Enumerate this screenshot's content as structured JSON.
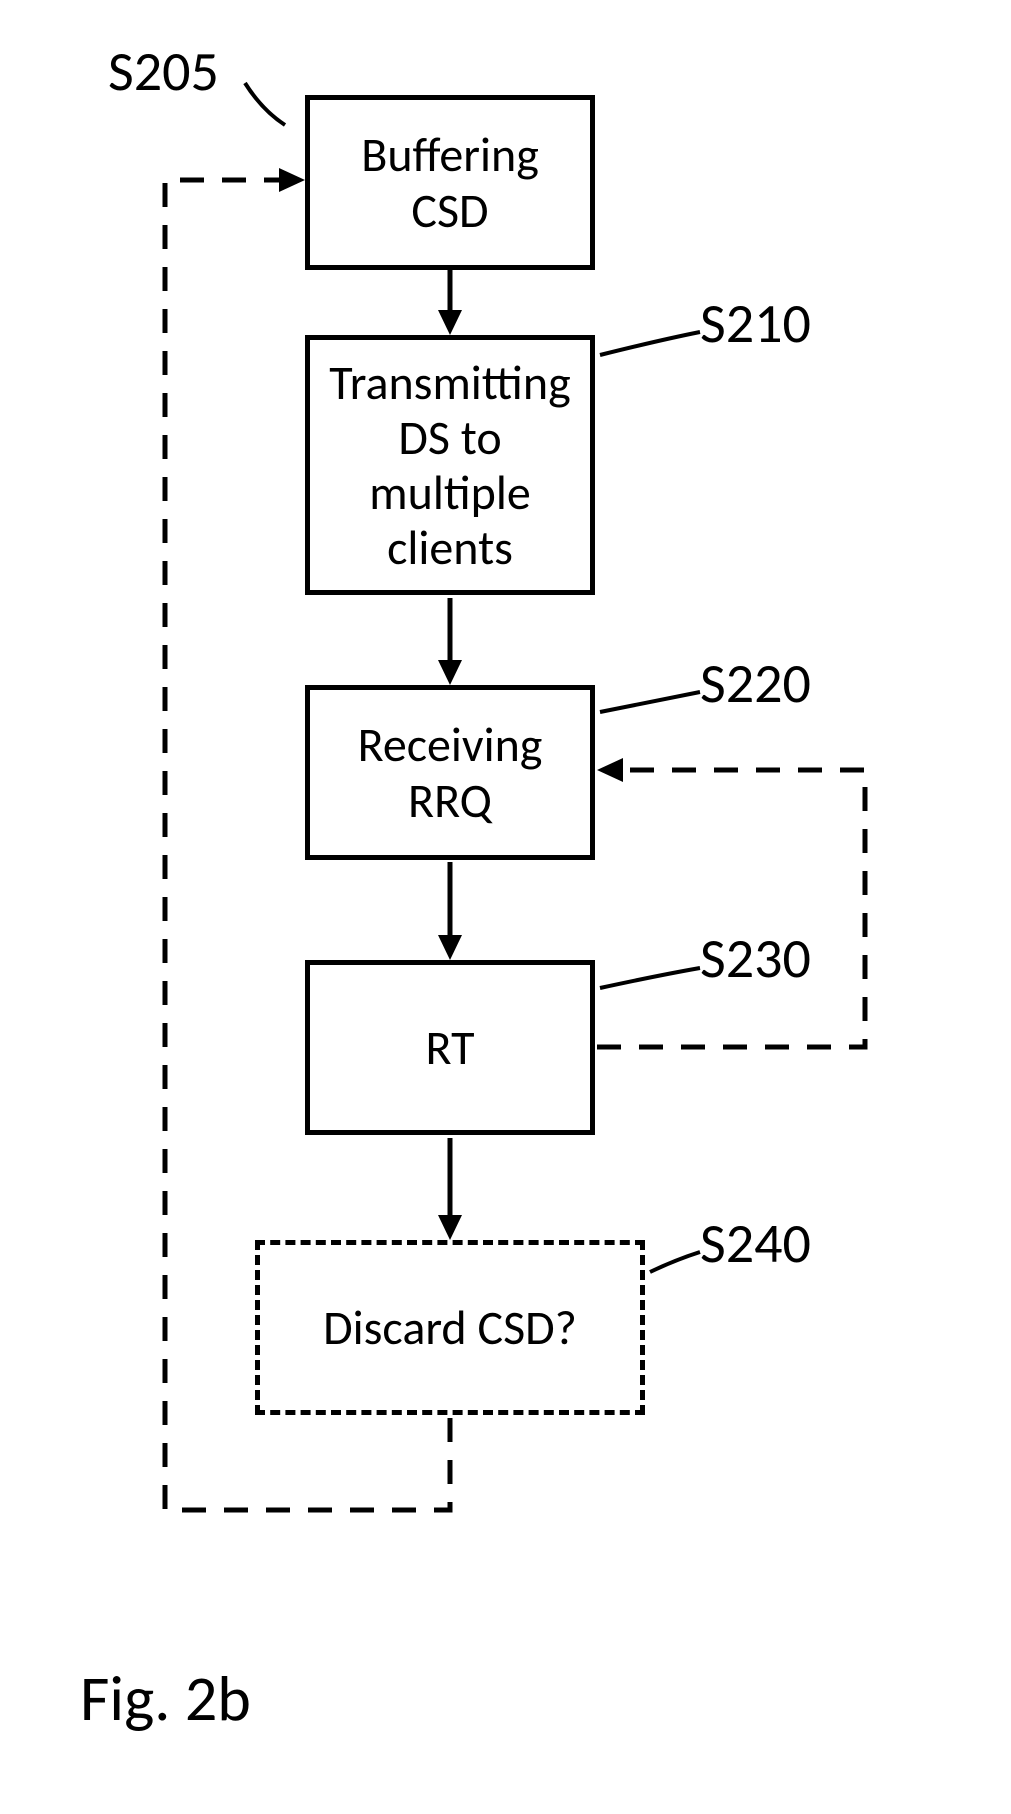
{
  "figure_caption": "Fig. 2b",
  "nodes": {
    "s205": {
      "label": "S205",
      "text": "Buffering CSD"
    },
    "s210": {
      "label": "S210",
      "text": "Transmitting DS to multiple clients"
    },
    "s220": {
      "label": "S220",
      "text": "Receiving RRQ"
    },
    "s230": {
      "label": "S230",
      "text": "RT"
    },
    "s240": {
      "label": "S240",
      "text": "Discard CSD?"
    }
  },
  "chart_data": {
    "type": "flowchart",
    "nodes": [
      {
        "id": "S205",
        "text": "Buffering CSD",
        "style": "solid"
      },
      {
        "id": "S210",
        "text": "Transmitting DS to multiple clients",
        "style": "solid"
      },
      {
        "id": "S220",
        "text": "Receiving RRQ",
        "style": "solid"
      },
      {
        "id": "S230",
        "text": "RT",
        "style": "solid"
      },
      {
        "id": "S240",
        "text": "Discard CSD?",
        "style": "dashed"
      }
    ],
    "edges": [
      {
        "from": "S205",
        "to": "S210",
        "style": "solid-arrow"
      },
      {
        "from": "S210",
        "to": "S220",
        "style": "solid-arrow"
      },
      {
        "from": "S220",
        "to": "S230",
        "style": "solid-arrow"
      },
      {
        "from": "S230",
        "to": "S240",
        "style": "solid-arrow"
      },
      {
        "from": "S230",
        "to": "S220",
        "style": "dashed-arrow",
        "note": "loop back"
      },
      {
        "from": "S240",
        "to": "S205",
        "style": "dashed-arrow",
        "note": "loop back"
      }
    ]
  }
}
